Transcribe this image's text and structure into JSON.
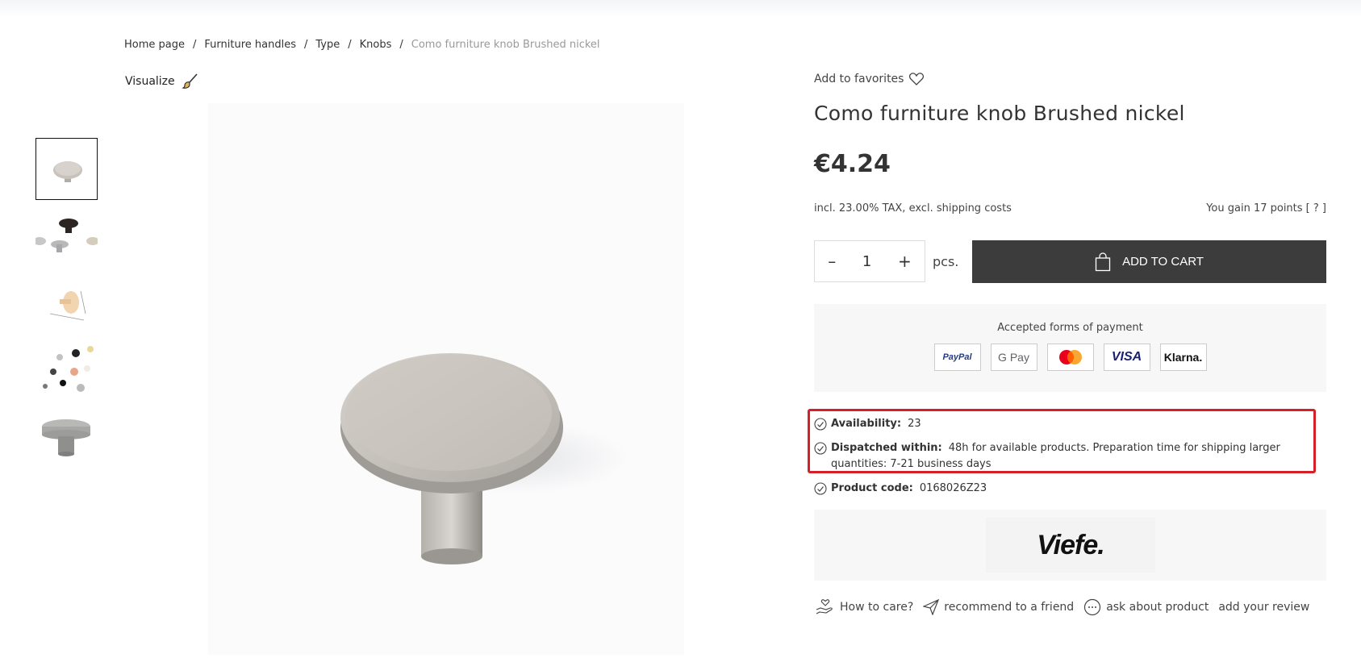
{
  "breadcrumb": {
    "items": [
      "Home page",
      "Furniture handles",
      "Type",
      "Knobs"
    ],
    "separator": "/",
    "current": "Como furniture knob Brushed nickel"
  },
  "visualize_label": "Visualize",
  "product": {
    "add_to_favorites": "Add to favorites",
    "title": "Como furniture knob Brushed nickel",
    "price": "€4.24",
    "tax_note": "incl. 23.00% TAX, excl. shipping costs",
    "points_note": "You gain 17 points [ ? ]",
    "quantity": "1",
    "minus": "–",
    "plus": "+",
    "unit": "pcs.",
    "add_to_cart": "ADD TO CART"
  },
  "payments": {
    "title": "Accepted forms of payment",
    "methods": [
      "PayPal",
      "G Pay",
      "Mastercard",
      "VISA",
      "Klarna."
    ]
  },
  "info": {
    "availability_label": "Availability:",
    "availability_value": "23",
    "dispatch_label": "Dispatched within:",
    "dispatch_value": "48h for available products. Preparation time for shipping larger quantities: 7-21 business days",
    "code_label": "Product code:",
    "code_value": "0168026Z23"
  },
  "brand": {
    "logo_text": "Viefe."
  },
  "links": {
    "care": "How to care?",
    "recommend": "recommend to a friend",
    "ask": "ask about product",
    "review": "add your review"
  },
  "colors": {
    "cart_bg": "#3c3c3c",
    "highlight": "#d62027",
    "panel_bg": "#f7f7f7"
  }
}
